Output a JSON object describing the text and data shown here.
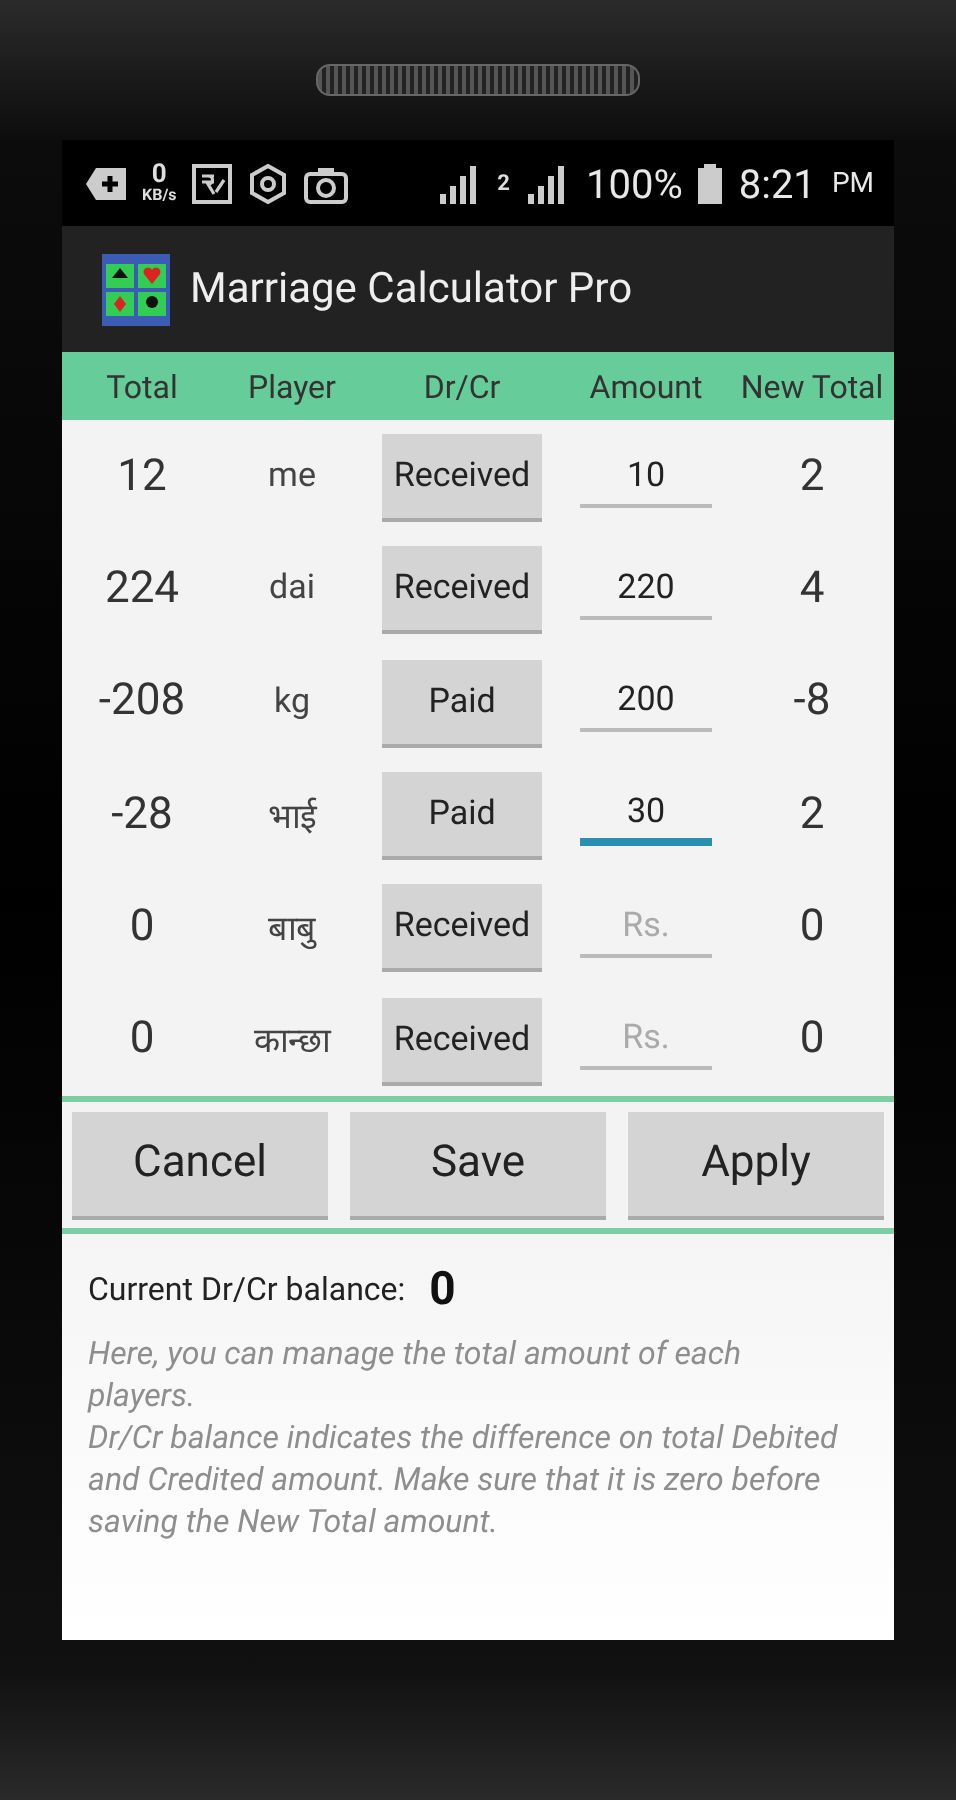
{
  "status_bar": {
    "network_speed": "0",
    "speed_unit": "KB/s",
    "sim_label": "2",
    "battery": "100%",
    "time": "8:21",
    "ampm": "PM"
  },
  "app_bar": {
    "title": "Marriage Calculator Pro"
  },
  "table": {
    "columns": [
      "Total",
      "Player",
      "Dr/Cr",
      "Amount",
      "New Total"
    ],
    "rows": [
      {
        "total": "12",
        "player": "me",
        "drcr": "Received",
        "amount": "10",
        "focused": false,
        "new_total": "2"
      },
      {
        "total": "224",
        "player": "dai",
        "drcr": "Received",
        "amount": "220",
        "focused": false,
        "new_total": "4"
      },
      {
        "total": "-208",
        "player": "kg",
        "drcr": "Paid",
        "amount": "200",
        "focused": false,
        "new_total": "-8"
      },
      {
        "total": "-28",
        "player": "भाई",
        "drcr": "Paid",
        "amount": "30",
        "focused": true,
        "new_total": "2"
      },
      {
        "total": "0",
        "player": "बाबु",
        "drcr": "Received",
        "placeholder": "Rs.",
        "focused": false,
        "new_total": "0"
      },
      {
        "total": "0",
        "player": "कान्छा",
        "drcr": "Received",
        "placeholder": "Rs.",
        "focused": false,
        "new_total": "0"
      }
    ]
  },
  "buttons": [
    "Cancel",
    "Save",
    "Apply"
  ],
  "balance": {
    "label": "Current Dr/Cr balance:",
    "value": "0"
  },
  "hint": [
    "Here, you can manage the total amount of each players.",
    "Dr/Cr balance indicates the difference on total Debited and Credited amount. Make sure that it is zero before saving the New Total amount."
  ]
}
